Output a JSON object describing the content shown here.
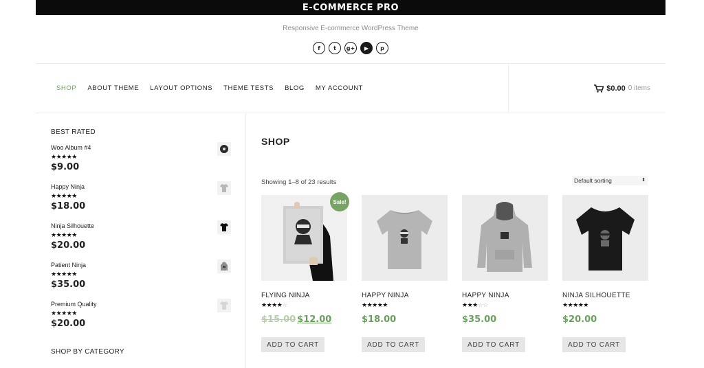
{
  "header": {
    "site_title": "E-COMMERCE PRO",
    "tagline": "Responsive E-commerce WordPress Theme",
    "socials": [
      {
        "icon": "facebook-icon",
        "glyph": "f"
      },
      {
        "icon": "twitter-icon",
        "glyph": "t"
      },
      {
        "icon": "google-plus-icon",
        "glyph": "g+"
      },
      {
        "icon": "youtube-icon",
        "glyph": "▶"
      },
      {
        "icon": "pinterest-icon",
        "glyph": "p"
      }
    ]
  },
  "nav": {
    "items": [
      "SHOP",
      "ABOUT THEME",
      "LAYOUT OPTIONS",
      "THEME TESTS",
      "BLOG",
      "MY ACCOUNT"
    ],
    "active_index": 0
  },
  "cart": {
    "icon": "cart-icon",
    "total": "$0.00",
    "count": "0 items"
  },
  "sidebar": {
    "best_rated_heading": "BEST RATED",
    "items": [
      {
        "name": "Woo Album #4",
        "stars": "★★★★★",
        "rating": 5,
        "price": "$9.00",
        "thumb": "album"
      },
      {
        "name": "Happy Ninja",
        "stars": "★★★★★",
        "rating": 5,
        "price": "$18.00",
        "thumb": "tshirt-grey"
      },
      {
        "name": "Ninja Silhouette",
        "stars": "★★★★★",
        "rating": 5,
        "price": "$20.00",
        "thumb": "tshirt-black"
      },
      {
        "name": "Patient Ninja",
        "stars": "★★★★★",
        "rating": 5,
        "price": "$35.00",
        "thumb": "hoodie"
      },
      {
        "name": "Premium Quality",
        "stars": "★★★★★",
        "rating": 5,
        "price": "$20.00",
        "thumb": "tshirt-light"
      }
    ],
    "category_heading": "SHOP BY CATEGORY"
  },
  "main": {
    "title": "SHOP",
    "result_count": "Showing 1–8 of 23 results",
    "sort_value": "Default sorting",
    "add_to_cart_label": "ADD TO CART",
    "products": [
      {
        "name": "FLYING NINJA",
        "rating": 4,
        "stars_full": "★★★★",
        "stars_empty": "☆",
        "price_old": "$15.00",
        "price": "$12.00",
        "sale": "Sale!",
        "kind": "poster"
      },
      {
        "name": "HAPPY NINJA",
        "rating": 5,
        "stars_full": "★★★★★",
        "stars_empty": "",
        "price_old": "",
        "price": "$18.00",
        "sale": "",
        "kind": "tshirt-grey"
      },
      {
        "name": "HAPPY NINJA",
        "rating": 3,
        "stars_full": "★★★",
        "stars_empty": "☆☆",
        "price_old": "",
        "price": "$35.00",
        "sale": "",
        "kind": "hoodie"
      },
      {
        "name": "NINJA SILHOUETTE",
        "rating": 5,
        "stars_full": "★★★★★",
        "stars_empty": "",
        "price_old": "",
        "price": "$20.00",
        "sale": "",
        "kind": "tshirt-black"
      }
    ]
  },
  "colors": {
    "accent": "#6a9e5f",
    "sale_badge": "#77a464",
    "topbar": "#0b0b0b"
  }
}
